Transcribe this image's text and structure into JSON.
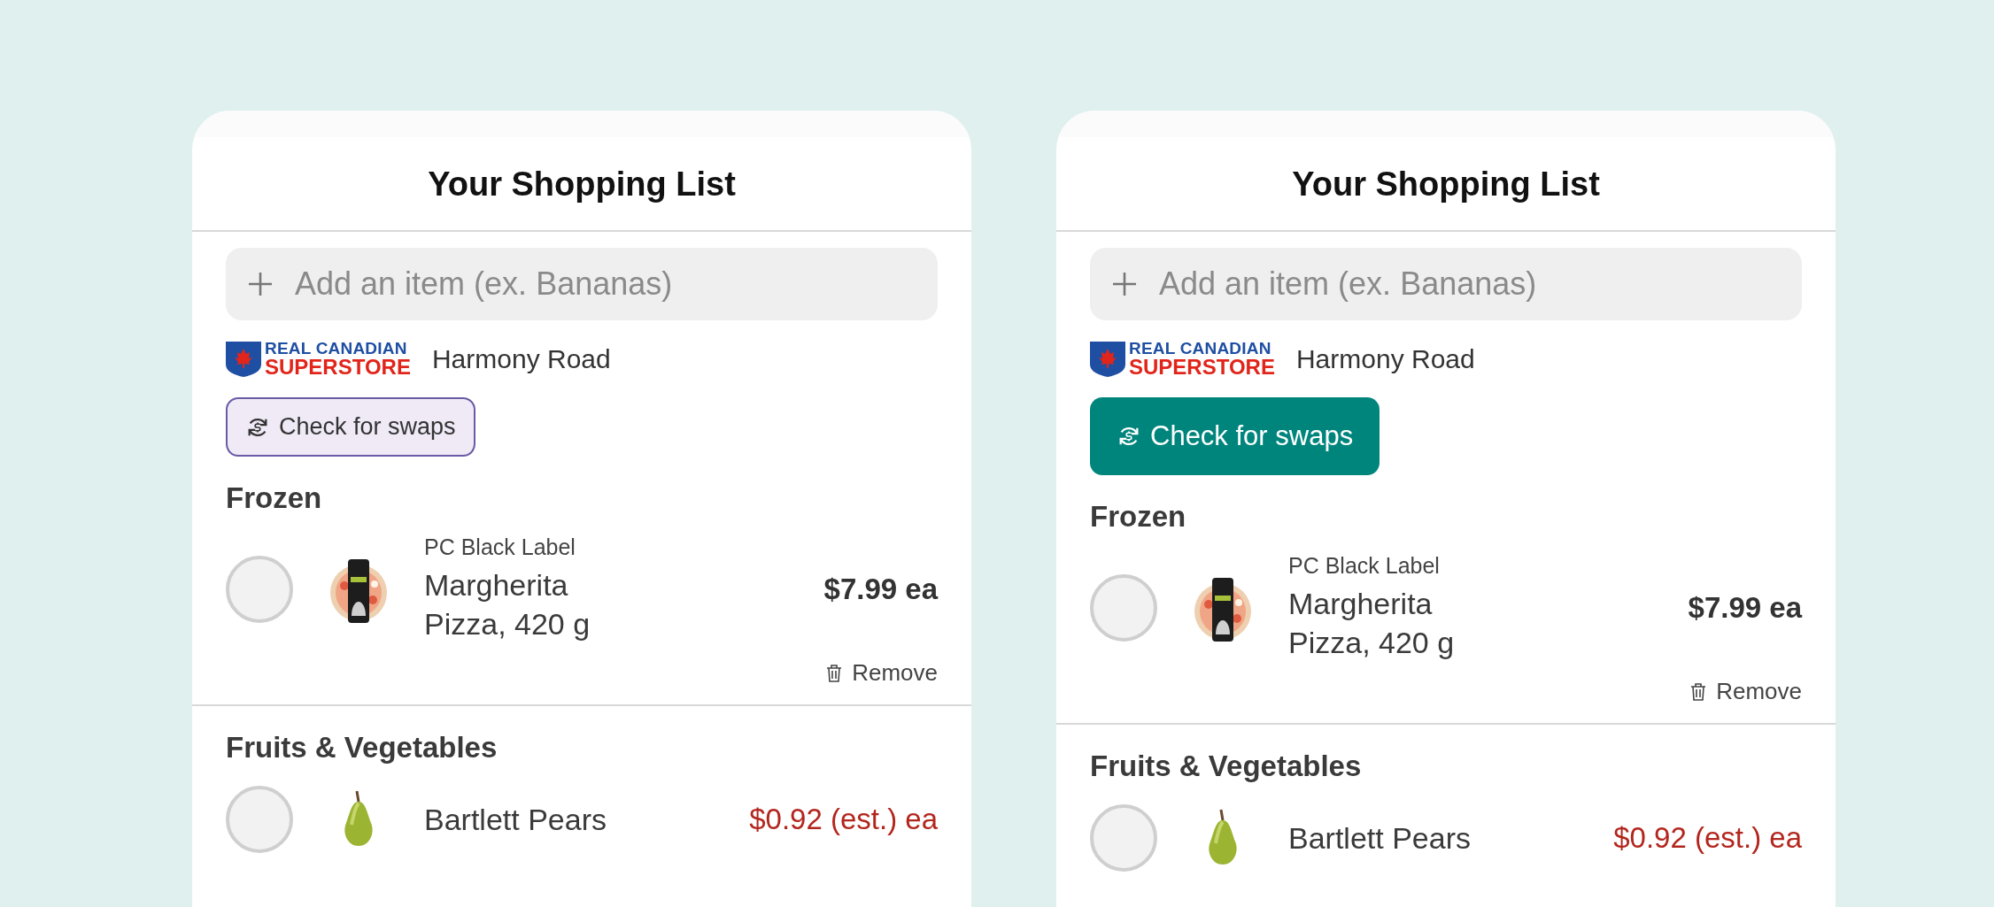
{
  "cards": [
    {
      "title": "Your Shopping List",
      "search": {
        "placeholder": "Add an item (ex. Bananas)"
      },
      "store": {
        "logo_top": "REAL CANADIAN",
        "logo_bottom": "SUPERSTORE",
        "location": "Harmony Road"
      },
      "swap_button": {
        "label": "Check for swaps",
        "kind": "outline"
      },
      "sections": [
        {
          "name": "Frozen",
          "items": [
            {
              "brand": "PC Black Label",
              "name": "Margherita Pizza, 420 g",
              "price": "$7.99 ea",
              "estimated": false,
              "checked": false,
              "remove": "Remove"
            }
          ]
        },
        {
          "name": "Fruits & Vegetables",
          "items": [
            {
              "name": "Bartlett Pears",
              "price": "$0.92 (est.) ea",
              "estimated": true,
              "checked": false
            }
          ]
        }
      ]
    },
    {
      "title": "Your Shopping List",
      "search": {
        "placeholder": "Add an item (ex. Bananas)"
      },
      "store": {
        "logo_top": "REAL CANADIAN",
        "logo_bottom": "SUPERSTORE",
        "location": "Harmony Road"
      },
      "swap_button": {
        "label": "Check for swaps",
        "kind": "filled"
      },
      "sections": [
        {
          "name": "Frozen",
          "items": [
            {
              "brand": "PC Black Label",
              "name": "Margherita Pizza, 420 g",
              "price": "$7.99 ea",
              "estimated": false,
              "checked": false,
              "remove": "Remove"
            }
          ]
        },
        {
          "name": "Fruits & Vegetables",
          "items": [
            {
              "name": "Bartlett Pears",
              "price": "$0.92 (est.) ea",
              "estimated": true,
              "checked": false
            }
          ]
        }
      ]
    }
  ]
}
